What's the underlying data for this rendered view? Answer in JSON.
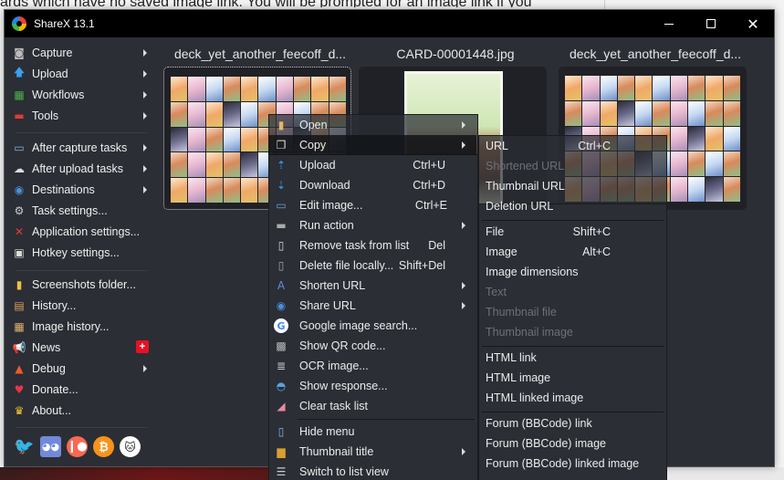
{
  "background": {
    "text": "ards which have no saved image link. You will be prompted for an image link if you"
  },
  "window": {
    "title": "ShareX 13.1",
    "controls": {
      "minimize": "minimize",
      "maximize": "maximize",
      "close": "✕"
    }
  },
  "main_menu": {
    "items": [
      {
        "label": "Capture",
        "icon": "camera-icon",
        "submenu": true
      },
      {
        "label": "Upload",
        "icon": "upload-arrow-icon",
        "submenu": true
      },
      {
        "label": "Workflows",
        "icon": "workflows-grid-icon",
        "submenu": true
      },
      {
        "label": "Tools",
        "icon": "toolbox-icon",
        "submenu": true
      },
      {
        "label": "After capture tasks",
        "icon": "after-capture-icon",
        "submenu": true
      },
      {
        "label": "After upload tasks",
        "icon": "cloud-upload-icon",
        "submenu": true
      },
      {
        "label": "Destinations",
        "icon": "globe-drive-icon",
        "submenu": true
      },
      {
        "label": "Task settings...",
        "icon": "gear-icon",
        "submenu": false
      },
      {
        "label": "Application settings...",
        "icon": "wrench-screwdriver-icon",
        "submenu": false
      },
      {
        "label": "Hotkey settings...",
        "icon": "keyboard-key-icon",
        "submenu": false
      },
      {
        "label": "Screenshots folder...",
        "icon": "folder-icon",
        "submenu": false
      },
      {
        "label": "History...",
        "icon": "history-icon",
        "submenu": false
      },
      {
        "label": "Image history...",
        "icon": "image-history-icon",
        "submenu": false
      },
      {
        "label": "News",
        "icon": "megaphone-icon",
        "submenu": false,
        "badge": "+"
      },
      {
        "label": "Debug",
        "icon": "traffic-cone-icon",
        "submenu": true
      },
      {
        "label": "Donate...",
        "icon": "heart-icon",
        "submenu": false
      },
      {
        "label": "About...",
        "icon": "crown-icon",
        "submenu": false
      }
    ],
    "social": [
      {
        "name": "twitter",
        "color": "#1da1f2"
      },
      {
        "name": "discord",
        "color": "#7289da"
      },
      {
        "name": "patreon",
        "color": "#f96854"
      },
      {
        "name": "bitcoin",
        "color": "#f7931a"
      },
      {
        "name": "github",
        "color": "#ffffff"
      }
    ]
  },
  "thumbnails": [
    {
      "title": "deck_yet_another_feecoff_d...",
      "selected": true
    },
    {
      "title": "CARD-00001448.jpg",
      "selected": false
    },
    {
      "title": "deck_yet_another_feecoff_d...",
      "selected": false
    }
  ],
  "context_menu": {
    "items": [
      {
        "label": "Open",
        "shortcut": "",
        "submenu": true,
        "icon": "open-folder-icon"
      },
      {
        "label": "Copy",
        "shortcut": "",
        "submenu": true,
        "icon": "copy-icon"
      },
      {
        "label": "Upload",
        "shortcut": "Ctrl+U",
        "submenu": false,
        "icon": "upload-icon"
      },
      {
        "label": "Download",
        "shortcut": "Ctrl+D",
        "submenu": false,
        "icon": "download-icon"
      },
      {
        "label": "Edit image...",
        "shortcut": "Ctrl+E",
        "submenu": false,
        "icon": "edit-image-icon"
      },
      {
        "label": "Run action",
        "shortcut": "",
        "submenu": true,
        "icon": "terminal-icon"
      },
      {
        "label": "Remove task from list",
        "shortcut": "Del",
        "submenu": false,
        "icon": "remove-task-icon"
      },
      {
        "label": "Delete file locally...",
        "shortcut": "Shift+Del",
        "submenu": false,
        "icon": "delete-file-icon"
      },
      {
        "label": "Shorten URL",
        "shortcut": "",
        "submenu": true,
        "icon": "shorten-url-icon"
      },
      {
        "label": "Share URL",
        "shortcut": "",
        "submenu": true,
        "icon": "share-url-icon"
      },
      {
        "label": "Google image search...",
        "shortcut": "",
        "submenu": false,
        "icon": "google-icon"
      },
      {
        "label": "Show QR code...",
        "shortcut": "",
        "submenu": false,
        "icon": "qr-code-icon"
      },
      {
        "label": "OCR image...",
        "shortcut": "",
        "submenu": false,
        "icon": "ocr-icon"
      },
      {
        "label": "Show response...",
        "shortcut": "",
        "submenu": false,
        "icon": "response-icon"
      },
      {
        "label": "Clear task list",
        "shortcut": "",
        "submenu": false,
        "icon": "eraser-icon"
      },
      {
        "label": "Hide menu",
        "shortcut": "",
        "submenu": false,
        "icon": "hide-menu-icon"
      },
      {
        "label": "Thumbnail title",
        "shortcut": "",
        "submenu": true,
        "icon": "thumbnail-title-icon"
      },
      {
        "label": "Switch to list view",
        "shortcut": "",
        "submenu": false,
        "icon": "list-view-icon"
      }
    ]
  },
  "copy_submenu": {
    "items": [
      {
        "label": "URL",
        "shortcut": "Ctrl+C",
        "disabled": false
      },
      {
        "label": "Shortened URL",
        "shortcut": "",
        "disabled": true
      },
      {
        "label": "Thumbnail URL",
        "shortcut": "",
        "disabled": false
      },
      {
        "label": "Deletion URL",
        "shortcut": "",
        "disabled": false
      },
      {
        "label": "File",
        "shortcut": "Shift+C",
        "disabled": false
      },
      {
        "label": "Image",
        "shortcut": "Alt+C",
        "disabled": false
      },
      {
        "label": "Image dimensions",
        "shortcut": "",
        "disabled": false
      },
      {
        "label": "Text",
        "shortcut": "",
        "disabled": true
      },
      {
        "label": "Thumbnail file",
        "shortcut": "",
        "disabled": true
      },
      {
        "label": "Thumbnail image",
        "shortcut": "",
        "disabled": true
      },
      {
        "label": "HTML link",
        "shortcut": "",
        "disabled": false
      },
      {
        "label": "HTML image",
        "shortcut": "",
        "disabled": false
      },
      {
        "label": "HTML linked image",
        "shortcut": "",
        "disabled": false
      },
      {
        "label": "Forum (BBCode) link",
        "shortcut": "",
        "disabled": false
      },
      {
        "label": "Forum (BBCode) image",
        "shortcut": "",
        "disabled": false
      },
      {
        "label": "Forum (BBCode) linked image",
        "shortcut": "",
        "disabled": false
      }
    ]
  }
}
